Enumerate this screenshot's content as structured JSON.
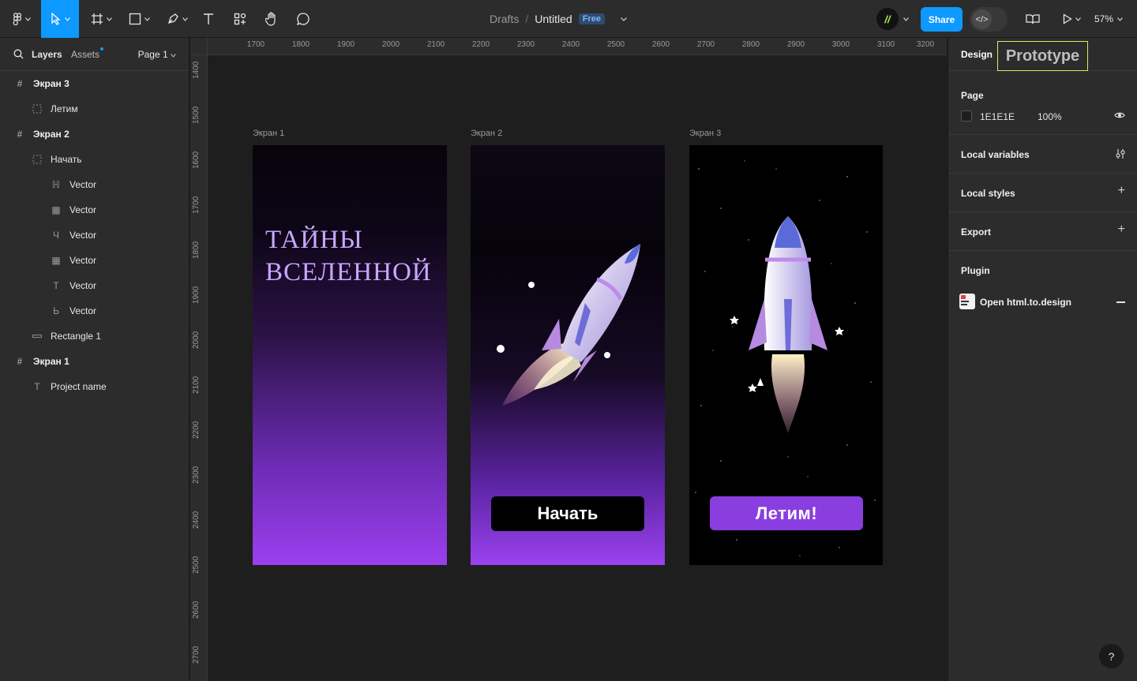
{
  "toolbar": {
    "title_drafts": "Drafts",
    "title_sep": "/",
    "title_file": "Untitled",
    "badge": "Free",
    "share": "Share",
    "zoom": "57%",
    "avatar_letter": "//"
  },
  "left": {
    "tab_layers": "Layers",
    "tab_assets": "Assets",
    "page": "Page 1",
    "layers": [
      {
        "label": "Экран 3",
        "kind": "frame"
      },
      {
        "label": "Летим",
        "kind": "child"
      },
      {
        "label": "Экран 2",
        "kind": "frame"
      },
      {
        "label": "Начать",
        "kind": "child"
      },
      {
        "label": "Vector",
        "kind": "vector"
      },
      {
        "label": "Vector",
        "kind": "vector"
      },
      {
        "label": "Vector",
        "kind": "vector"
      },
      {
        "label": "Vector",
        "kind": "vector"
      },
      {
        "label": "Vector",
        "kind": "vector"
      },
      {
        "label": "Vector",
        "kind": "vector"
      },
      {
        "label": "Rectangle 1",
        "kind": "child"
      },
      {
        "label": "Экран 1",
        "kind": "frame"
      },
      {
        "label": "Project name",
        "kind": "text"
      }
    ]
  },
  "rulers": {
    "h": [
      "1700",
      "1800",
      "1900",
      "2000",
      "2100",
      "2200",
      "2300",
      "2400",
      "2500",
      "2600",
      "2700",
      "2800",
      "2900",
      "3000",
      "3100",
      "3200"
    ],
    "v": [
      "1400",
      "1500",
      "1600",
      "1700",
      "1800",
      "1900",
      "2000",
      "2100",
      "2200",
      "2300",
      "2400",
      "2500",
      "2600",
      "2700"
    ]
  },
  "canvas": {
    "frame1_label": "Экран 1",
    "frame2_label": "Экран 2",
    "frame3_label": "Экран 3",
    "s1_title_line1": "ТАЙНЫ",
    "s1_title_line2": "ВСЕЛЕННОЙ",
    "s2_button": "Начать",
    "s3_button": "Летим!"
  },
  "right": {
    "tab_design": "Design",
    "tab_prototype": "Prototype",
    "page_heading": "Page",
    "page_color": "1E1E1E",
    "page_opacity": "100%",
    "local_variables": "Local variables",
    "local_styles": "Local styles",
    "export": "Export",
    "plugin": "Plugin",
    "plugin_item": "Open html.to.design"
  },
  "colors": {
    "accent": "#0d99ff",
    "highlight": "#d6f05c",
    "fly_button": "#8a3ee0"
  }
}
